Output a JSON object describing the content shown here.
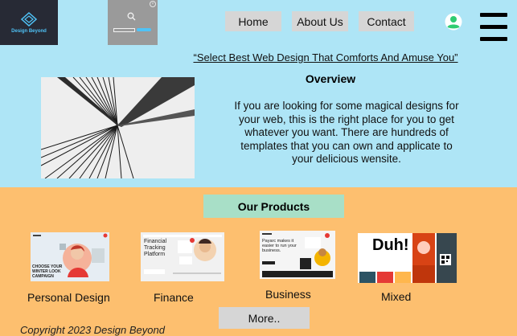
{
  "logo": {
    "text": "Design Beyond",
    "icon": "diamond-logo-icon"
  },
  "search_widget": {
    "icon": "search-icon",
    "close_icon": "close-icon"
  },
  "nav": {
    "home": "Home",
    "about": "About Us",
    "contact": "Contact"
  },
  "header_icons": {
    "avatar": "user-avatar-icon",
    "menu": "hamburger-menu-icon"
  },
  "tagline": "“Select Best Web Design That Comforts And Amuse You”",
  "overview": {
    "title": "Overview",
    "text": "If you are looking for some magical designs for your web, this is the right place for you to get whatever you want. There are hundreds of templates that you can own and applicate to your delicious wensite."
  },
  "products": {
    "title": "Our Products",
    "items": [
      {
        "label": "Personal Design",
        "thumb_text": "CHOOSE YOUR WINTER LOOK CAMPAIGN"
      },
      {
        "label": "Finance",
        "thumb_text": "Financial Tracking Platform"
      },
      {
        "label": "Business",
        "thumb_text": "Payarc makes it easier to run your business."
      },
      {
        "label": "Mixed",
        "thumb_text": "Duh!"
      }
    ],
    "more": "More.."
  },
  "footer": {
    "copyright": "Copyright 2023 Design Beyond"
  },
  "colors": {
    "top_bg": "#aee5f6",
    "bottom_bg": "#fdbf6f",
    "products_title_bg": "#a8dfc7",
    "button_bg": "#d6d6d6",
    "logo_bg": "#272a35"
  }
}
